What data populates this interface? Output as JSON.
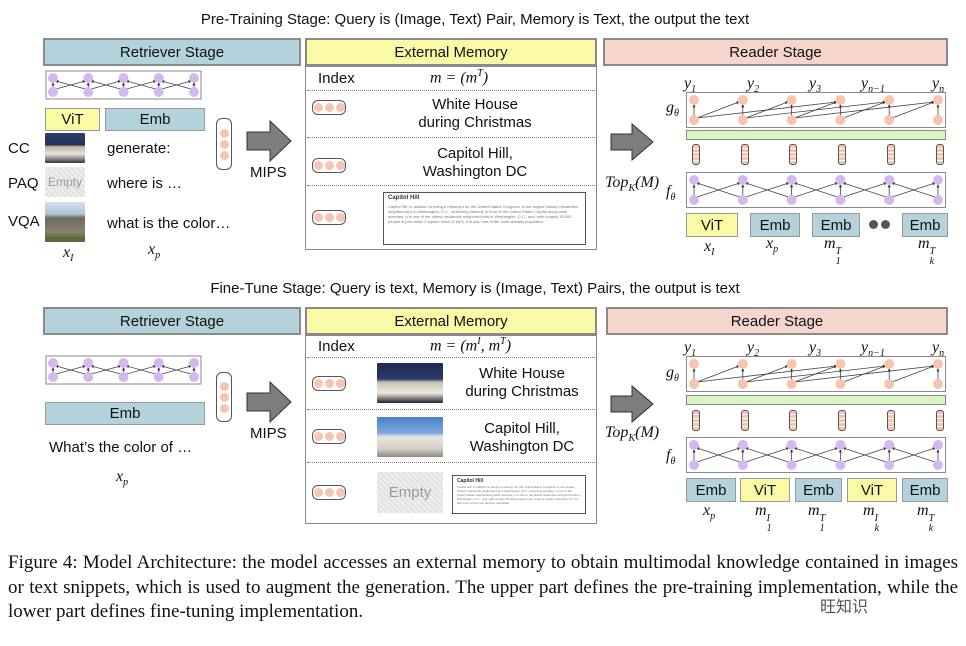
{
  "top": {
    "title": "Pre-Training Stage: Query is (Image, Text) Pair, Memory is Text, the output the text",
    "retriever_header": "Retriever Stage",
    "memory_header": "External Memory",
    "reader_header": "Reader Stage",
    "vit": "ViT",
    "emb": "Emb",
    "rows": [
      {
        "dataset": "CC",
        "text": "generate:"
      },
      {
        "dataset": "PAQ",
        "text": "where is …",
        "image": "Empty"
      },
      {
        "dataset": "VQA",
        "text": "what is the color…"
      }
    ],
    "mips": "MIPS",
    "index": "Index",
    "memory_formula": "m = (m",
    "memory_formula_sup": "T",
    "memory_formula_end": ")",
    "memory_items": [
      "White House\nduring Christmas",
      "Capitol Hill,\nWashington DC"
    ],
    "snippet_title": "Capitol Hill",
    "snippet_text": "Capitol Hill, in addition to being a metonym for the United States Congress, is the largest historic residential neighborhood in Washington, D.C., stretching easterly in front of the United States Capitol along wide avenues. It is one of the oldest residential neighborhoods in Washington, D.C., and, with roughly 35,000 people in just under 2 square miles (5 km²), it is also one of the most densely populated.",
    "topk": "Top",
    "topk_sub": "K",
    "topk_end": "(M)",
    "reader_inputs": [
      "ViT",
      "Emb",
      "Emb",
      "Emb"
    ]
  },
  "bottom": {
    "title": "Fine-Tune Stage: Query is text, Memory is (Image, Text) Pairs, the output is text",
    "retriever_header": "Retriever Stage",
    "memory_header": "External Memory",
    "reader_header": "Reader Stage",
    "emb": "Emb",
    "query": "What’s the color of …",
    "mips": "MIPS",
    "index": "Index",
    "memory_formula": "m = (m",
    "memory_formula_sup1": "I",
    "memory_formula_mid": ", m",
    "memory_formula_sup2": "T",
    "memory_formula_end": ")",
    "memory_items": [
      "White House\nduring Christmas",
      "Capitol Hill,\nWashington DC"
    ],
    "empty": "Empty",
    "snippet_title": "Capitol Hill",
    "snippet_text": "Capitol Hill, in addition to being a metonym for the United States Congress, is the largest historic residential neighborhood in Washington, D.C., stretching easterly in front of the United States Capitol along wide avenues. It is one of the oldest residential neighborhoods in Washington, D.C., and, with roughly 35,000 people in just under 2 square miles (5 km²), it is also one of the most densely populated.",
    "topk": "Top",
    "topk_sub": "K",
    "topk_end": "(M)",
    "reader_inputs": [
      "Emb",
      "ViT",
      "Emb",
      "ViT",
      "Emb"
    ]
  },
  "outputs": [
    {
      "b": "y",
      "s": "1"
    },
    {
      "b": "y",
      "s": "2"
    },
    {
      "b": "y",
      "s": "3"
    },
    {
      "b": "y",
      "s": "n−1"
    },
    {
      "b": "y",
      "s": "n"
    }
  ],
  "g_label": {
    "b": "g",
    "s": "θ"
  },
  "f_label": {
    "b": "f",
    "s": "θ"
  },
  "top_vars": {
    "retriever": [
      {
        "b": "x",
        "s": "I"
      },
      {
        "b": "x",
        "s": "p"
      }
    ],
    "reader": [
      {
        "b": "x",
        "s": "I"
      },
      {
        "b": "x",
        "s": "p"
      },
      {
        "b": "m",
        "s": "1",
        "p": "T"
      },
      {
        "b": "m",
        "s": "k",
        "p": "T"
      }
    ]
  },
  "bottom_vars": {
    "retriever": [
      {
        "b": "x",
        "s": "p"
      }
    ],
    "reader": [
      {
        "b": "x",
        "s": "p"
      },
      {
        "b": "m",
        "s": "1",
        "p": "I"
      },
      {
        "b": "m",
        "s": "1",
        "p": "T"
      },
      {
        "b": "m",
        "s": "k",
        "p": "I"
      },
      {
        "b": "m",
        "s": "k",
        "p": "T"
      }
    ]
  },
  "caption": "Figure 4: Model Architecture: the model accesses an external memory to obtain multimodal knowledge contained in images or text snippets, which is used to augment the generation.  The upper part defines the pre-training implementation, while the lower part defines fine-tuning implementation.",
  "watermark": "旺知识",
  "colors": {
    "retriever": "#b3d2dc",
    "memory": "#fafaa6",
    "reader": "#f6d6cc",
    "fusion": "#d8f5c2",
    "node_purple": "#d5b8f0",
    "node_peach": "#f5c5b2"
  }
}
